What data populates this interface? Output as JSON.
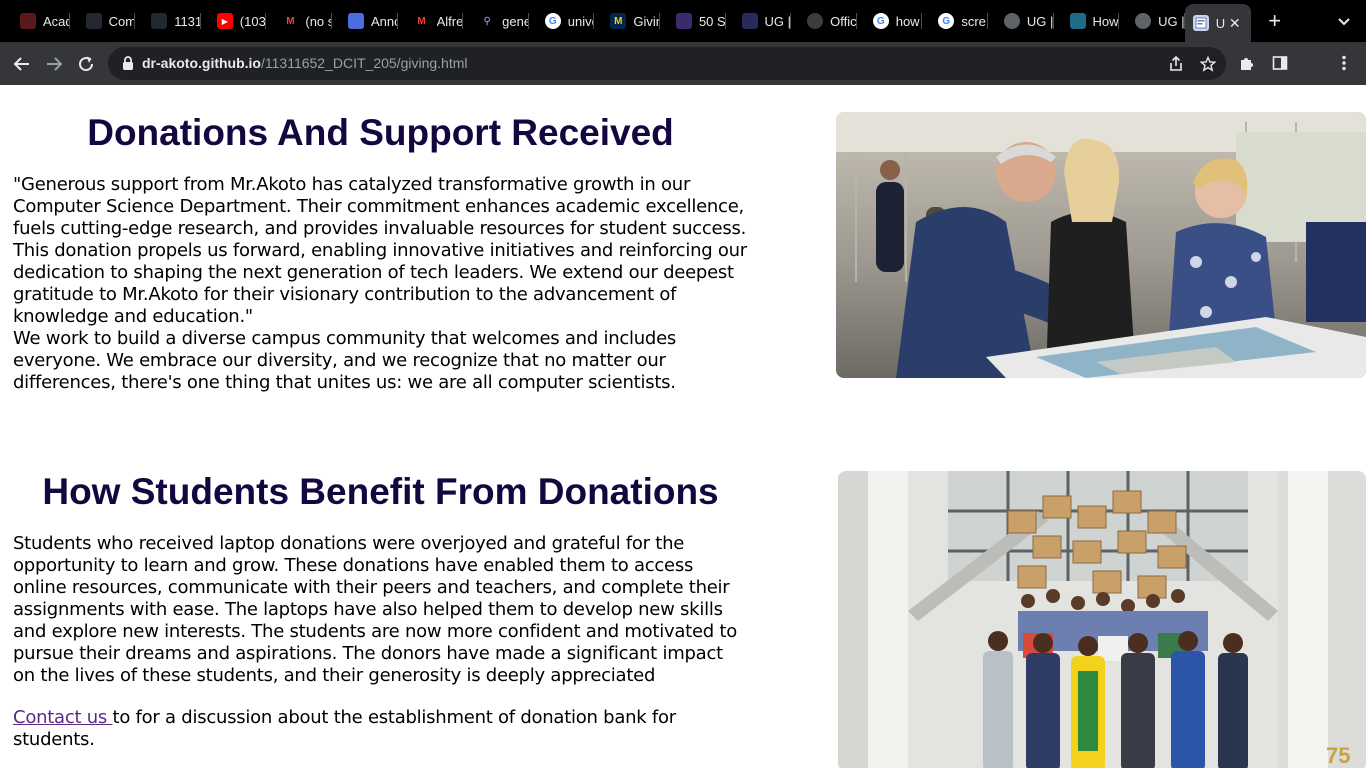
{
  "browser": {
    "tabs": [
      {
        "label": "Acad",
        "icon": "dark-logo-icon",
        "color": "#5a1a1a"
      },
      {
        "label": "Com",
        "icon": "github-icon",
        "color": "#24292f"
      },
      {
        "label": "1131",
        "icon": "github-icon",
        "color": "#24292f"
      },
      {
        "label": "(103",
        "icon": "youtube-icon",
        "color": "#ff0000"
      },
      {
        "label": "(no s",
        "icon": "gmail-icon",
        "color": "#c5221f"
      },
      {
        "label": "Anno",
        "icon": "document-icon",
        "color": "#4a6ee0"
      },
      {
        "label": "Alfre",
        "icon": "gmail-icon",
        "color": "#c5221f"
      },
      {
        "label": "gene",
        "icon": "search-icon",
        "color": "#1a73e8"
      },
      {
        "label": "unive",
        "icon": "google-icon",
        "color": "#ffffff"
      },
      {
        "label": "Givin",
        "icon": "michigan-m-icon",
        "color": "#00274c"
      },
      {
        "label": "50 S",
        "icon": "site-logo-icon",
        "color": "#3b2a6e"
      },
      {
        "label": "UG |",
        "icon": "dots-icon",
        "color": "#2a2a5a"
      },
      {
        "label": "Offic",
        "icon": "circle-icon",
        "color": "#3c3c3c"
      },
      {
        "label": "how",
        "icon": "google-icon",
        "color": "#ffffff"
      },
      {
        "label": "scre",
        "icon": "google-icon",
        "color": "#ffffff"
      },
      {
        "label": "UG |",
        "icon": "globe-icon",
        "color": "#5f6368"
      },
      {
        "label": "How",
        "icon": "site-logo-icon",
        "color": "#1f6b8a"
      },
      {
        "label": "UG |",
        "icon": "globe-icon",
        "color": "#5f6368"
      }
    ],
    "active_tab": {
      "label": "U",
      "icon": "site-page-icon",
      "color": "#c9d6f0"
    },
    "close_glyph": "✕",
    "new_tab_glyph": "+",
    "url_host": "dr-akoto.github.io",
    "url_path": "/11311652_DCIT_205/giving.html"
  },
  "section1": {
    "title": "Donations And Support Received",
    "paragraph1": "\"Generous support from Mr.Akoto has catalyzed transformative growth in our Computer Science Department. Their commitment enhances academic excellence, fuels cutting-edge research, and provides invaluable resources for student success. This donation propels us forward, enabling innovative initiatives and reinforcing our dedication to shaping the next generation of tech leaders. We extend our deepest gratitude to Mr.Akoto for their visionary contribution to the advancement of knowledge and education.\"",
    "paragraph2": "We work to build a diverse campus community that welcomes and includes everyone. We embrace our diversity, and we recognize that no matter our differences, there's one thing that unites us: we are all computer scientists."
  },
  "section2": {
    "title": "How Students Benefit From Donations",
    "paragraph": "Students who received laptop donations were overjoyed and grateful for the opportunity to learn and grow. These donations have enabled them to access online resources, communicate with their peers and teachers, and complete their assignments with ease. The laptops have also helped them to develop new skills and explore new interests. The students are now more confident and motivated to pursue their dreams and aspirations. The donors have made a significant impact on the lives of these students, and their generosity is deeply appreciated",
    "contact_link": "Contact us ",
    "contact_rest": "to for a discussion about the establishment of donation bank for students."
  },
  "colors": {
    "heading": "#14073f",
    "link": "#5b2a86",
    "chrome_dark": "#000000",
    "toolbar": "#35363a"
  }
}
